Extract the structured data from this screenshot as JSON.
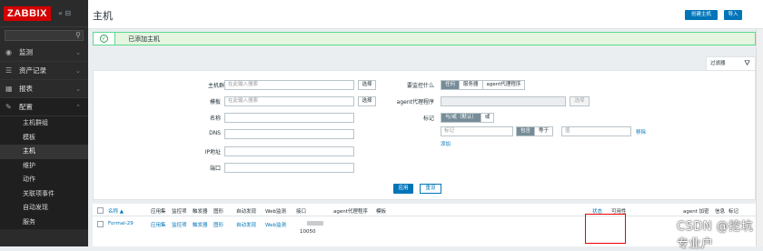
{
  "sidebar": {
    "logo": "ZABBIX",
    "collapse_glyph": "«",
    "menu": [
      {
        "label": "监测",
        "icon": "eye-icon"
      },
      {
        "label": "资产记录",
        "icon": "list-icon"
      },
      {
        "label": "报表",
        "icon": "report-icon"
      },
      {
        "label": "配置",
        "icon": "wrench-icon"
      }
    ],
    "submenu": [
      "主机群组",
      "模板",
      "主机",
      "维护",
      "动作",
      "关联项事件",
      "自动发现",
      "服务"
    ]
  },
  "header": {
    "title": "主机",
    "create_host": "创建主机",
    "import": "导入"
  },
  "message": {
    "text": "已添加主机",
    "icon": "check-icon"
  },
  "filter": {
    "tab_label": "过滤器",
    "host_groups_label": "主机群组",
    "host_groups_placeholder": "在此输入搜索",
    "templates_label": "模板",
    "templates_placeholder": "在此输入搜索",
    "select": "选择",
    "name_label": "名称",
    "dns_label": "DNS",
    "ip_label": "IP地址",
    "port_label": "端口",
    "monitored_by_label": "要监控什么",
    "monitored_by": [
      "任何",
      "服务器",
      "agent代理程序"
    ],
    "proxy_label": "agent代理程序",
    "tags_label": "标记",
    "tags_eval": [
      "与/或（默认）",
      "或"
    ],
    "tag_placeholder": "标记",
    "tag_ops": [
      "包含",
      "等于"
    ],
    "value_placeholder": "值",
    "remove": "移除",
    "add": "添加",
    "apply": "应用",
    "reset": "重设"
  },
  "table": {
    "headers": [
      "名称 ▲",
      "应用集",
      "监控项",
      "触发器",
      "图形",
      "自动发现",
      "Web监测",
      "接口",
      "agent代理程序",
      "模板",
      "状态",
      "可用性",
      "agent 加密",
      "信息",
      "标记"
    ],
    "row": {
      "name": "Formal-29",
      "links": [
        "应用集",
        "监控项",
        "触发器",
        "图形",
        "自动发现",
        "Web监测"
      ],
      "port": "10050"
    }
  },
  "watermark": "CSDN @挖坑专业户"
}
